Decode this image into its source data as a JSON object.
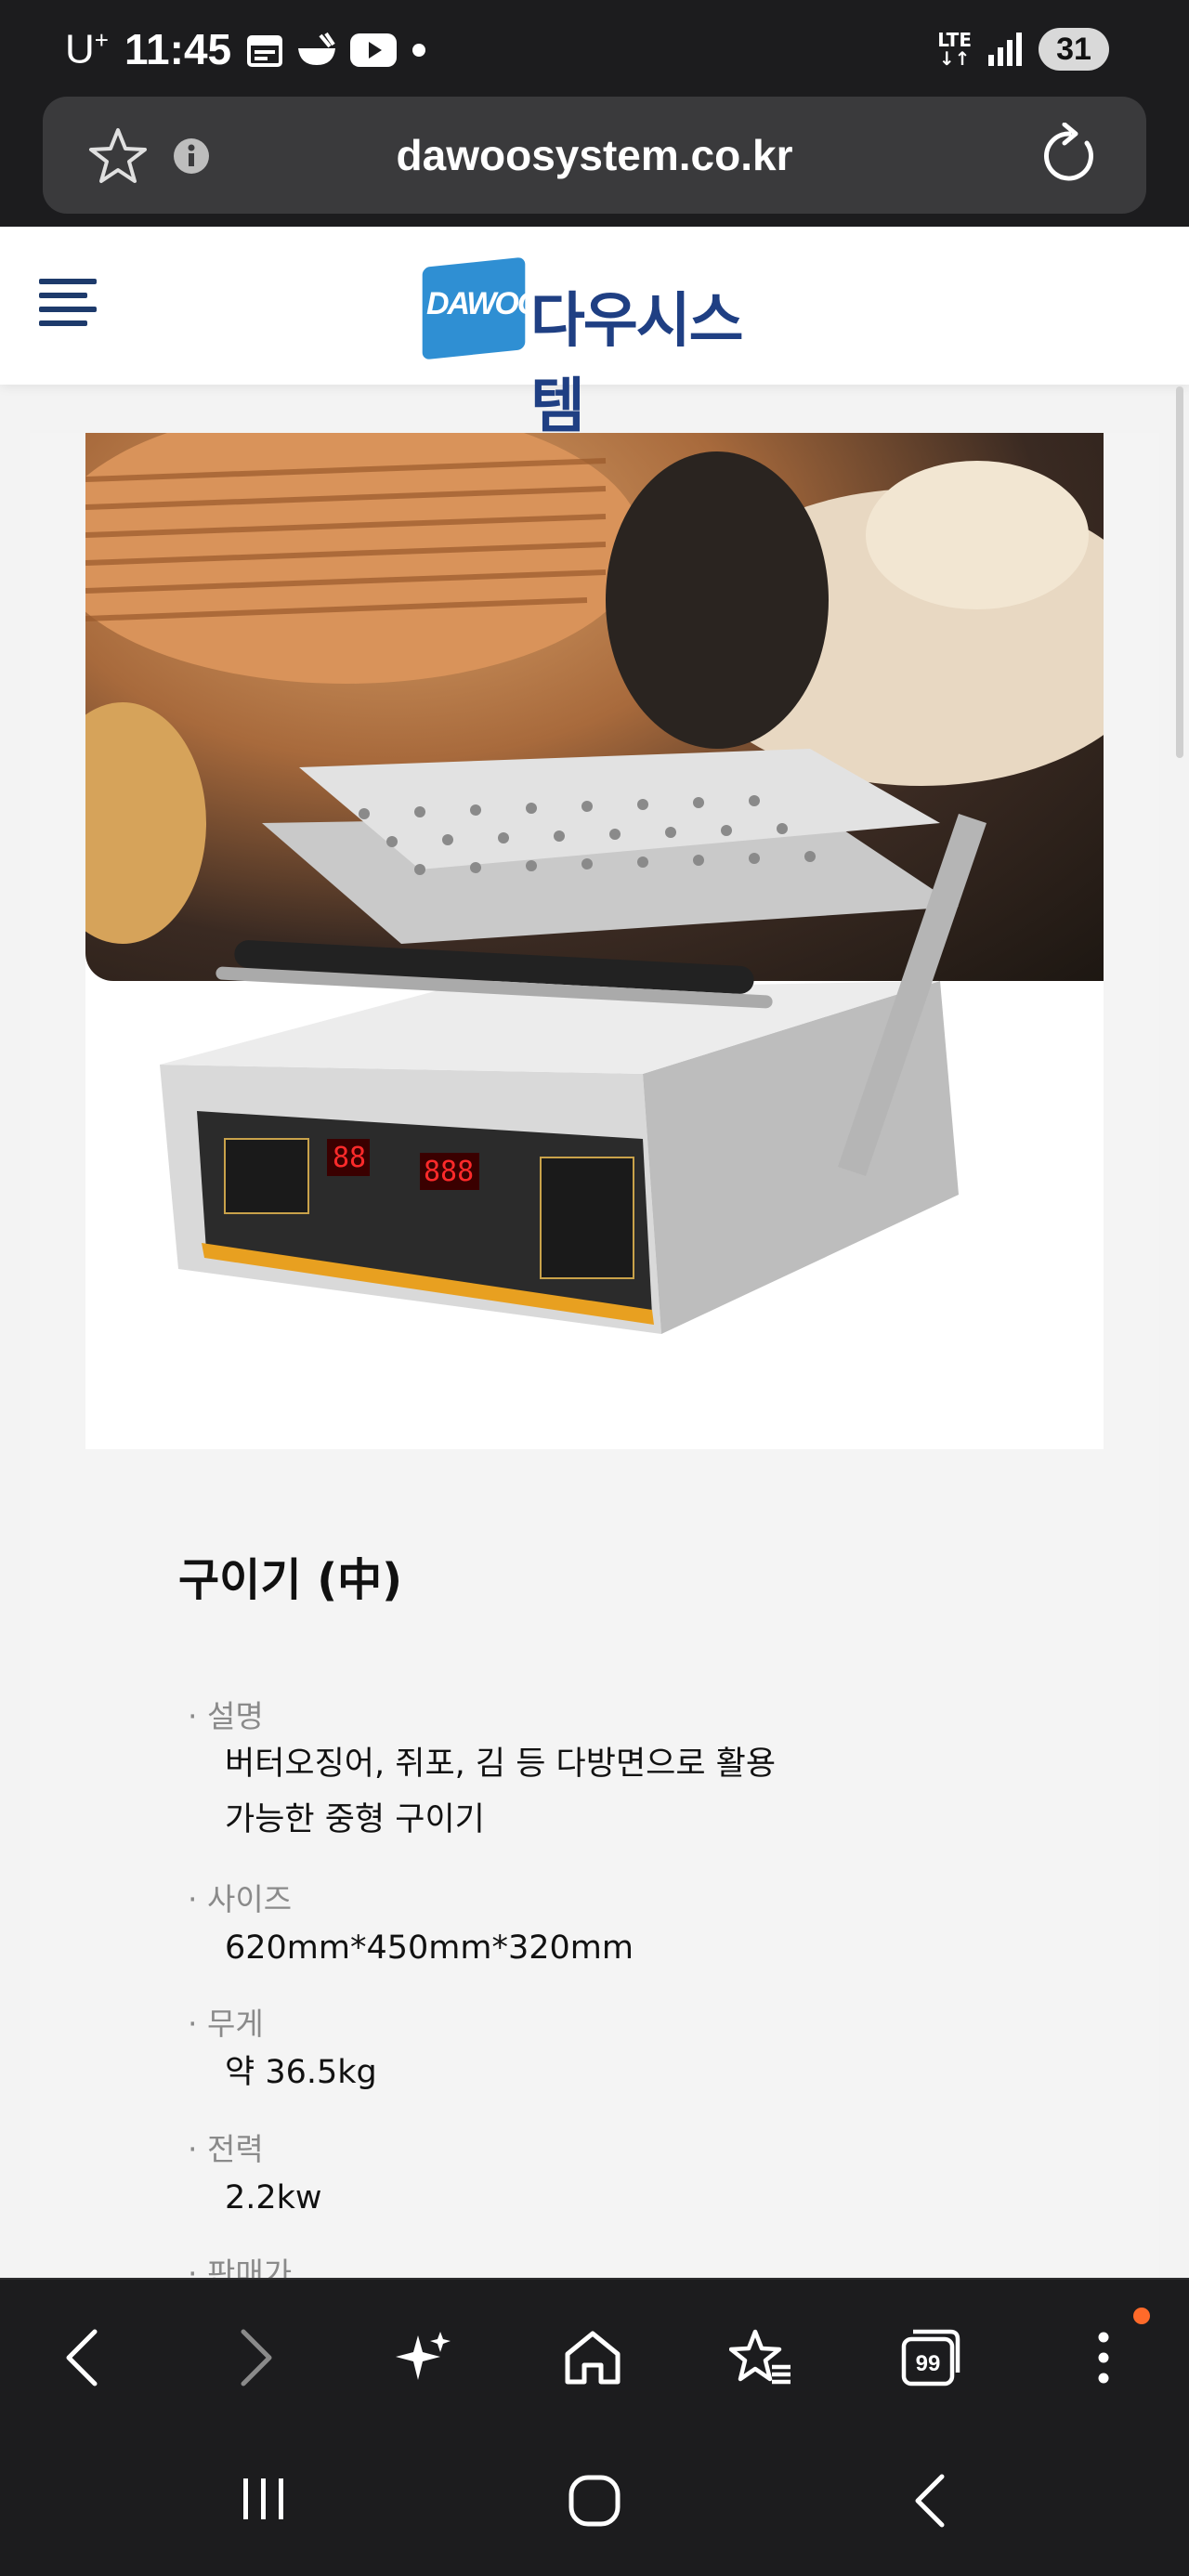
{
  "status_bar": {
    "carrier": "U",
    "carrier_sup": "+",
    "time": "11:45",
    "network": "LTE",
    "battery": "31"
  },
  "url_bar": {
    "url": "dawoosystem.co.kr"
  },
  "site_header": {
    "logo_badge": "DAWOO",
    "logo_text": "다우시스템"
  },
  "product": {
    "title": "구이기 (中)",
    "specs": [
      {
        "label": "· 설명",
        "value_lines": [
          "버터오징어, 쥐포, 김 등 다방면으로 활용",
          "가능한 중형 구이기"
        ]
      },
      {
        "label": "· 사이즈",
        "value_lines": [
          "620mm*450mm*320mm"
        ]
      },
      {
        "label": "· 무게",
        "value_lines": [
          "약 36.5kg"
        ]
      },
      {
        "label": "· 전력",
        "value_lines": [
          "2.2kw"
        ]
      },
      {
        "label": "· 판매가",
        "value_lines": []
      }
    ]
  },
  "browser_nav": {
    "tabs_count": "99"
  },
  "colors": {
    "brand_blue": "#1f3f83",
    "logo_badge_blue": "#2f8fd3",
    "chrome_dark": "#1c1c1e",
    "notification": "#ff6a2a"
  }
}
